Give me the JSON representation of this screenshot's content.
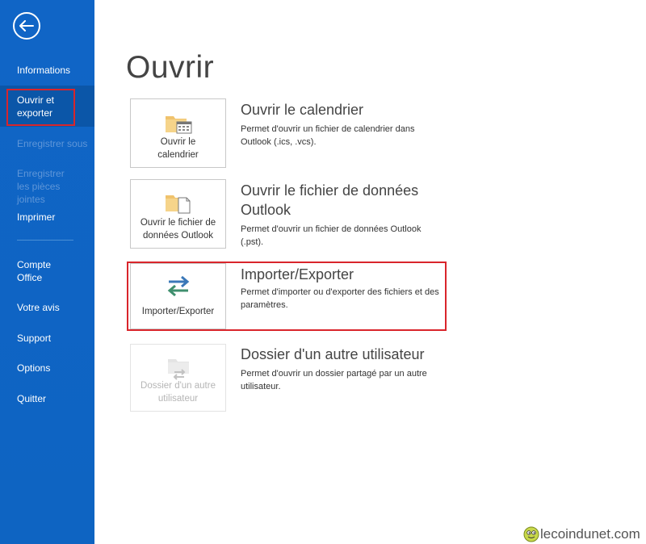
{
  "sidebar": {
    "items": [
      {
        "label": "Informations",
        "state": "normal"
      },
      {
        "label": "Ouvrir et exporter",
        "state": "selected"
      },
      {
        "label": "Enregistrer sous",
        "state": "disabled"
      },
      {
        "label": "Enregistrer les pièces jointes",
        "state": "disabled"
      },
      {
        "label": "Imprimer",
        "state": "normal"
      },
      {
        "label": "Compte Office",
        "state": "normal"
      },
      {
        "label": "Votre avis",
        "state": "normal"
      },
      {
        "label": "Support",
        "state": "normal"
      },
      {
        "label": "Options",
        "state": "normal"
      },
      {
        "label": "Quitter",
        "state": "normal"
      }
    ]
  },
  "main": {
    "title": "Ouvrir",
    "options": [
      {
        "tile_label": "Ouvrir le calendrier",
        "title": "Ouvrir le calendrier",
        "description": "Permet d'ouvrir un fichier de calendrier dans Outlook (.ics, .vcs).",
        "icon": "calendar-folder-icon",
        "enabled": true
      },
      {
        "tile_label": "Ouvrir le fichier de données Outlook",
        "title": "Ouvrir le fichier de données Outlook",
        "description": "Permet d'ouvrir un fichier de données Outlook (.pst).",
        "icon": "data-file-folder-icon",
        "enabled": true
      },
      {
        "tile_label": "Importer/Exporter",
        "title": "Importer/Exporter",
        "description": "Permet d'importer ou d'exporter des fichiers et des paramètres.",
        "icon": "import-export-arrows-icon",
        "enabled": true
      },
      {
        "tile_label": "Dossier d'un autre utilisateur",
        "title": "Dossier d'un autre utilisateur",
        "description": "Permet d'ouvrir un dossier partagé par un autre utilisateur.",
        "icon": "shared-folder-icon",
        "enabled": false
      }
    ]
  },
  "watermark": {
    "text": "lecoindunet.com"
  },
  "colors": {
    "sidebar": "#0e64c2",
    "sidebar_selected": "#0b56a8",
    "sidebar_disabled_text": "#5f96d8",
    "highlight_box": "#d9252b",
    "folder": "#f0c36d",
    "arrow_blue": "#3b78b8",
    "arrow_green": "#3f8f6e"
  }
}
